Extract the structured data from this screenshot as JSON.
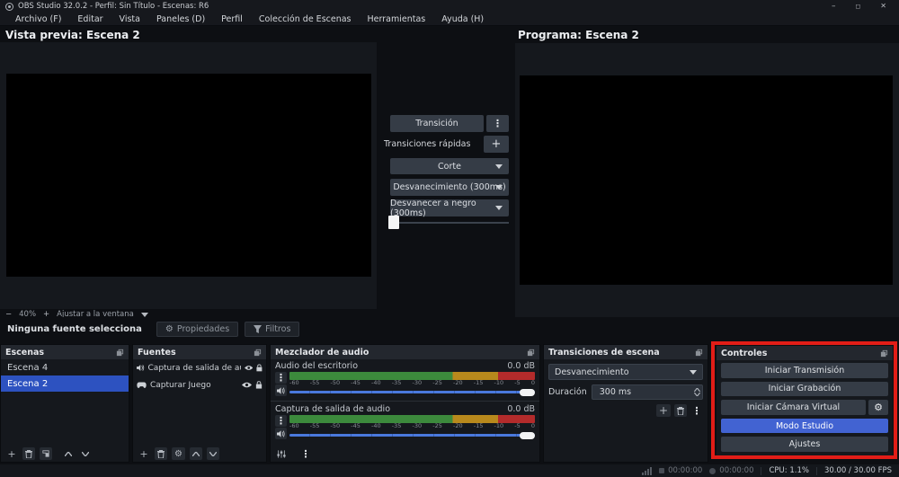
{
  "window": {
    "title": "OBS Studio 32.0.2 - Perfil: Sin Título - Escenas: R6",
    "minimize": "–",
    "maximize": "◻",
    "close": "✕"
  },
  "menu": {
    "items": [
      "Archivo (F)",
      "Editar",
      "Vista",
      "Paneles (D)",
      "Perfil",
      "Colección de Escenas",
      "Herramientas",
      "Ayuda (H)"
    ]
  },
  "preview": {
    "title": "Vista previa: Escena 2",
    "zoom_out": "−",
    "zoom_level": "40%",
    "zoom_in": "+",
    "fit_label": "Ajustar a la ventana"
  },
  "program": {
    "title": "Programa: Escena 2"
  },
  "transition_panel": {
    "transition_button": "Transición",
    "menu_button": "⋮",
    "quick_transitions_label": "Transiciones rápidas",
    "add_button": "+",
    "cut": "Corte",
    "fade": "Desvanecimiento (300ms)",
    "fade_to_black": "Desvanecer a negro (300ms)"
  },
  "source_toolbar": {
    "no_source": "Ninguna fuente selecciona",
    "properties": "Propiedades",
    "filters": "Filtros"
  },
  "scenes": {
    "header": "Escenas",
    "items": [
      {
        "label": "Escena 4"
      },
      {
        "label": "Escena 2"
      }
    ],
    "add": "+"
  },
  "sources": {
    "header": "Fuentes",
    "items": [
      {
        "label": "Captura de salida de audio"
      },
      {
        "label": "Capturar Juego"
      }
    ],
    "add": "+"
  },
  "mixer": {
    "header": "Mezclador de audio",
    "channels": [
      {
        "name": "Audio del escritorio",
        "level": "0.0 dB"
      },
      {
        "name": "Captura de salida de audio",
        "level": "0.0 dB"
      }
    ],
    "ticks": [
      "-60",
      "-55",
      "-50",
      "-45",
      "-40",
      "-35",
      "-30",
      "-25",
      "-20",
      "-15",
      "-10",
      "-5",
      "0"
    ],
    "menu_button": "⋮"
  },
  "scene_transitions": {
    "header": "Transiciones de escena",
    "selected": "Desvanecimiento",
    "duration_label": "Duración",
    "duration_value": "300 ms",
    "add": "+"
  },
  "controls": {
    "header": "Controles",
    "start_streaming": "Iniciar Transmisión",
    "start_recording": "Iniciar Grabación",
    "virtual_camera": "Iniciar Cámara Virtual",
    "studio_mode": "Modo Estudio",
    "settings": "Ajustes"
  },
  "statusbar": {
    "stream_time": "00:00:00",
    "rec_time": "00:00:00",
    "cpu": "CPU: 1.1%",
    "fps": "30.00 / 30.00 FPS"
  },
  "colors": {
    "accent_blue": "#2d52c0",
    "studio_mode_blue": "#4263d2",
    "highlight_red": "#e21d17",
    "meter_green": "#3c8a3c",
    "meter_yellow": "#b8891c",
    "meter_red": "#b32b2b"
  }
}
